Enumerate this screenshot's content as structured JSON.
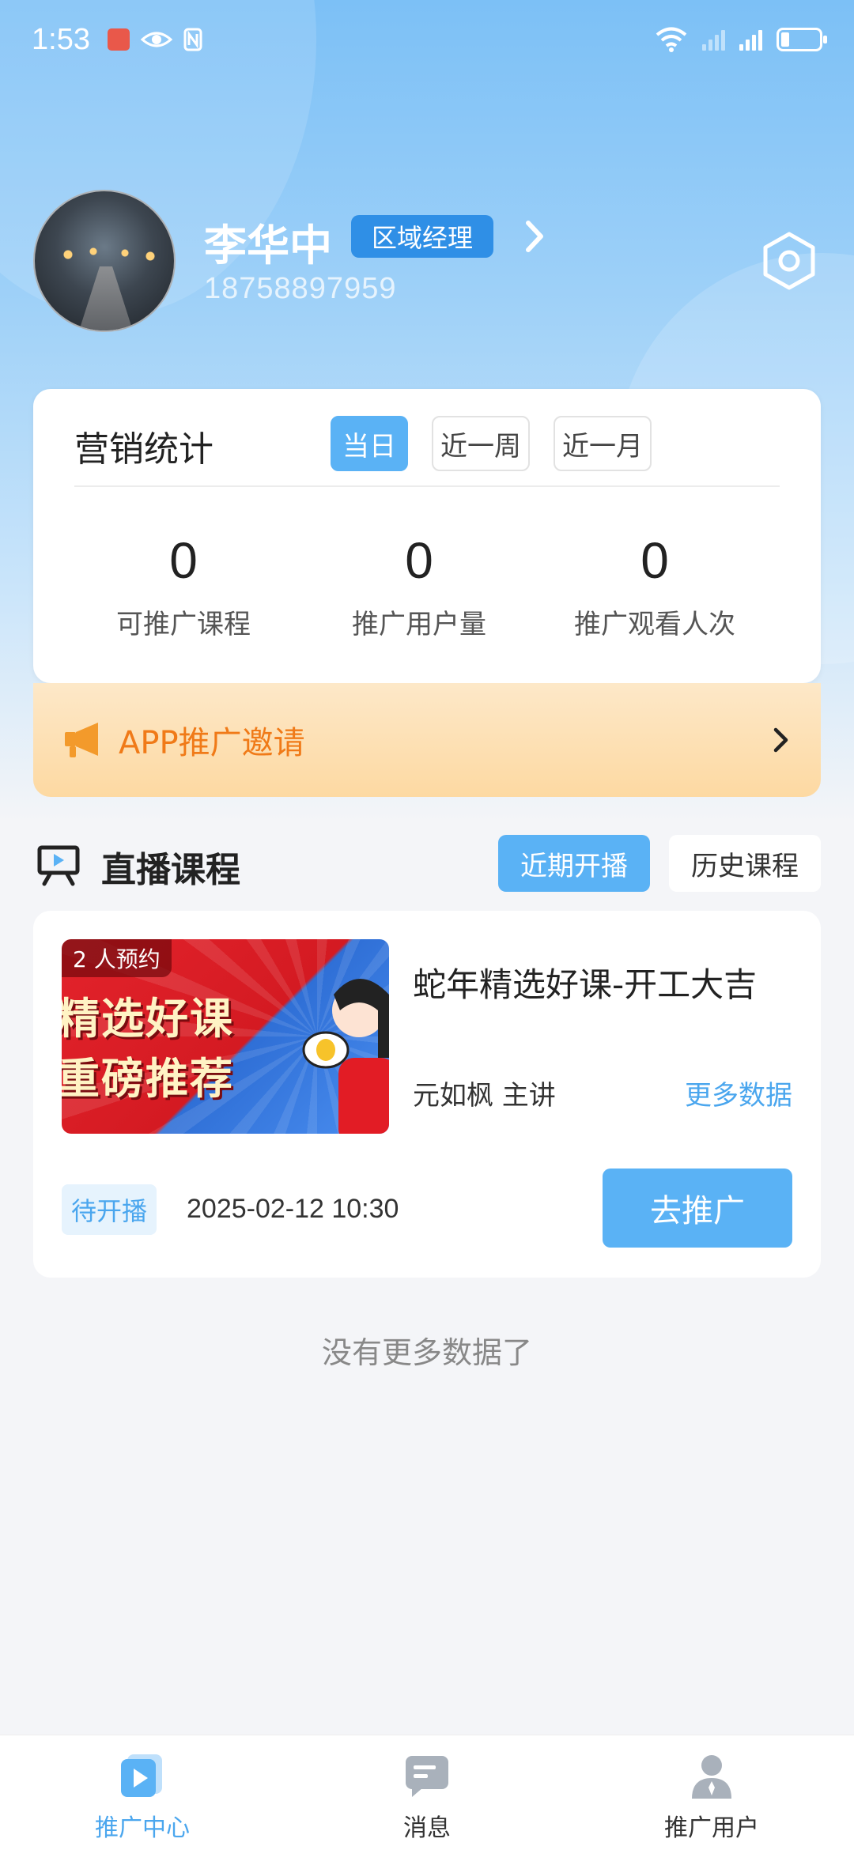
{
  "status_bar": {
    "time": "1:53"
  },
  "profile": {
    "name": "李华中",
    "role": "区域经理",
    "phone": "18758897959"
  },
  "stats": {
    "title": "营销统计",
    "periods": [
      "当日",
      "近一周",
      "近一月"
    ],
    "active_period": "当日",
    "items": [
      {
        "value": "0",
        "label": "可推广课程"
      },
      {
        "value": "0",
        "label": "推广用户量"
      },
      {
        "value": "0",
        "label": "推广观看人次"
      }
    ]
  },
  "invite": {
    "label": "APP推广邀请"
  },
  "section": {
    "title": "直播课程",
    "tabs": [
      "近期开播",
      "历史课程"
    ],
    "active_tab": "近期开播"
  },
  "course": {
    "reserve_badge": "2 人预约",
    "cover_line1": "精选好课",
    "cover_line2": "重磅推荐",
    "title": "蛇年精选好课-开工大吉",
    "lecturer": "元如枫 主讲",
    "more_data": "更多数据",
    "status": "待开播",
    "time": "2025-02-12 10:30",
    "promote_label": "去推广"
  },
  "no_more": "没有更多数据了",
  "bottom_nav": {
    "items": [
      {
        "label": "推广中心",
        "icon": "play-icon",
        "active": true
      },
      {
        "label": "消息",
        "icon": "message-icon",
        "active": false
      },
      {
        "label": "推广用户",
        "icon": "user-icon",
        "active": false
      }
    ]
  },
  "colors": {
    "accent": "#5ab2f5",
    "role_badge": "#2f8fe6",
    "invite_text": "#f07a18"
  }
}
